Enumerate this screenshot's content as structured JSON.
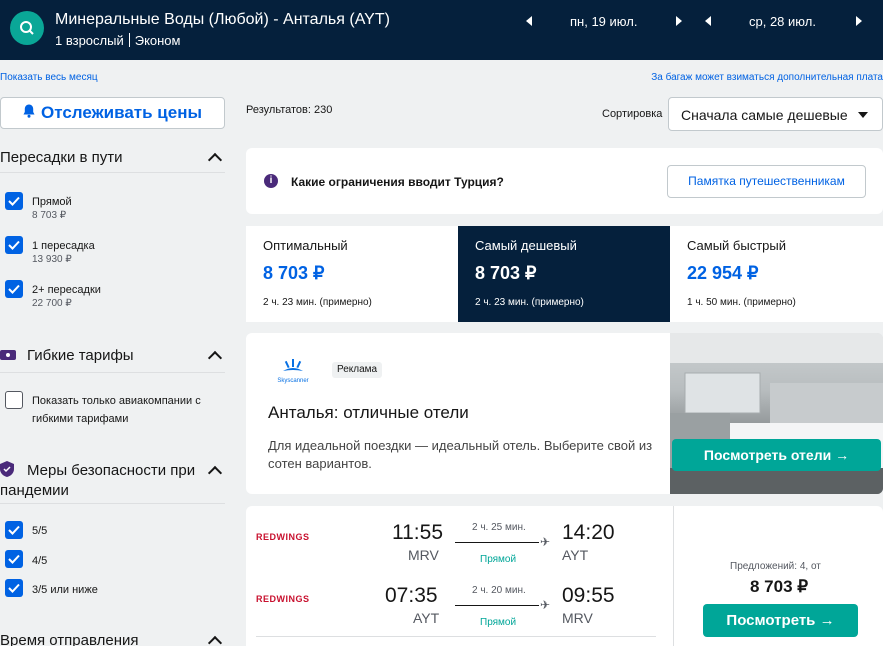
{
  "header": {
    "route": "Минеральные Воды (Любой) - Анталья (AYT)",
    "passengers": "1 взрослый",
    "cabin": "Эконом",
    "depart_date": "пн, 19 июл.",
    "return_date": "ср, 28 июл."
  },
  "links": {
    "show_month": "Показать весь месяц",
    "baggage_note": "За багаж может взиматься дополнительная плата"
  },
  "sidebar": {
    "track_button": "Отслеживать цены",
    "stops": {
      "title": "Пересадки в пути",
      "items": [
        {
          "label": "Прямой",
          "price": "8 703 ₽",
          "checked": true
        },
        {
          "label": "1 пересадка",
          "price": "13 930 ₽",
          "checked": true
        },
        {
          "label": "2+ пересадки",
          "price": "22 700 ₽",
          "checked": true
        }
      ]
    },
    "flex": {
      "title": "Гибкие тарифы",
      "option_line1": "Показать только авиакомпании с",
      "option_line2": "гибкими тарифами",
      "checked": false
    },
    "safety": {
      "title_line1": "Меры безопасности при",
      "title_line2": "пандемии",
      "items": [
        {
          "label": "5/5",
          "checked": true
        },
        {
          "label": "4/5",
          "checked": true
        },
        {
          "label": "3/5 или ниже",
          "checked": true
        }
      ]
    },
    "departure": {
      "title": "Время отправления"
    }
  },
  "main": {
    "results": "Результатов: 230",
    "sort_label": "Сортировка",
    "sort_value": "Сначала самые дешевые",
    "notice": {
      "text": "Какие ограничения вводит Турция?",
      "button": "Памятка путешественникам"
    },
    "tabs": [
      {
        "label": "Оптимальный",
        "price": "8 703 ₽",
        "duration": "2 ч. 23 мин. (примерно)",
        "active": false
      },
      {
        "label": "Самый дешевый",
        "price": "8 703 ₽",
        "duration": "2 ч. 23 мин. (примерно)",
        "active": true
      },
      {
        "label": "Самый быстрый",
        "price": "22 954 ₽",
        "duration": "1 ч. 50 мин. (примерно)",
        "active": false
      }
    ],
    "ad": {
      "logo_text": "Skyscanner",
      "badge": "Реклама",
      "title": "Анталья: отличные отели",
      "text": "Для идеальной поездки — идеальный отель. Выберите свой из сотен вариантов.",
      "button": "Посмотреть отели"
    },
    "flight": {
      "legs": [
        {
          "airline": "REDWINGS",
          "dep_time": "11:55",
          "dep_code": "MRV",
          "duration": "2 ч. 25 мин.",
          "stops": "Прямой",
          "arr_time": "14:20",
          "arr_code": "AYT"
        },
        {
          "airline": "REDWINGS",
          "dep_time": "07:35",
          "dep_code": "AYT",
          "duration": "2 ч. 20 мин.",
          "stops": "Прямой",
          "arr_time": "09:55",
          "arr_code": "MRV"
        }
      ],
      "offers": "Предложений: 4, от",
      "price": "8 703 ₽",
      "button": "Посмотреть"
    }
  },
  "colors": {
    "header_bg": "#05203c",
    "accent_blue": "#0062e3",
    "teal": "#00a698"
  }
}
